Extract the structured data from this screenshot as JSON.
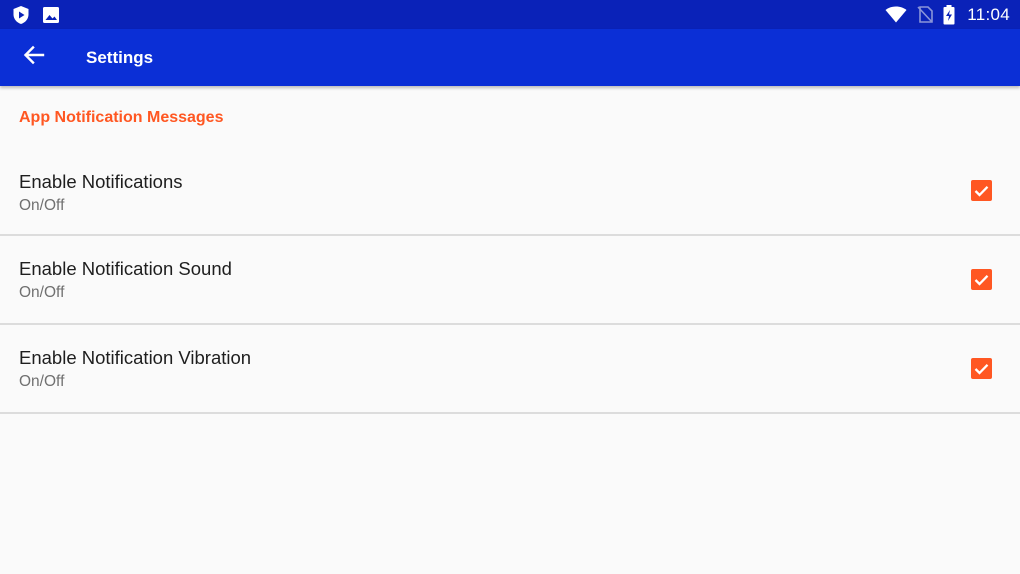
{
  "status_bar": {
    "time": "11:04",
    "left_icons": [
      "shield-play-icon",
      "image-icon"
    ],
    "right_icons": [
      "wifi-icon",
      "no-sim-icon",
      "battery-charging-icon"
    ]
  },
  "app_bar": {
    "title": "Settings",
    "back_icon": "arrow-back-icon"
  },
  "settings": {
    "category_title": "App Notification Messages",
    "items": [
      {
        "title": "Enable Notifications",
        "summary": "On/Off",
        "checked": true
      },
      {
        "title": "Enable Notification Sound",
        "summary": "On/Off",
        "checked": true
      },
      {
        "title": "Enable Notification Vibration",
        "summary": "On/Off",
        "checked": true
      }
    ]
  },
  "colors": {
    "status_bar": "#0a22b8",
    "app_bar": "#0b2fd6",
    "accent": "#ff5722",
    "background": "#fafafa"
  }
}
